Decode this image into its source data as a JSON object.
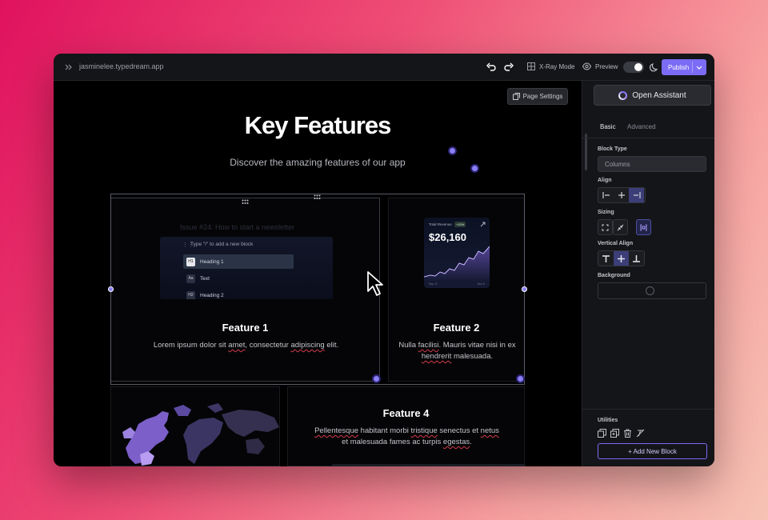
{
  "topbar": {
    "url": "jasminelee.typedream.app",
    "xray_label": "X-Ray Mode",
    "preview_label": "Preview",
    "publish_label": "Publish"
  },
  "canvas": {
    "page_settings_label": "Page Settings",
    "hero_title": "Key Features",
    "hero_subtitle": "Discover the amazing features of our app",
    "editor_preview": {
      "ghost_title": "Issue #24: How to start a newsletter",
      "hint": "Type \"/\" to add a new block",
      "items": [
        {
          "icon": "H1",
          "label": "Heading 1"
        },
        {
          "icon": "Aa",
          "label": "Text"
        },
        {
          "icon": "H2",
          "label": "Heading 2"
        }
      ]
    },
    "revenue_card": {
      "label": "Total Revenue",
      "badge": "+15%",
      "value": "$26,160",
      "x_start": "Sep 11",
      "x_end": "Nov 8"
    },
    "features": [
      {
        "title": "Feature 1",
        "desc_a": "Lorem ipsum dolor sit ",
        "desc_b": "amet",
        "desc_c": ", consectetur ",
        "desc_d": "adipiscing",
        "desc_e": " elit."
      },
      {
        "title": "Feature 2",
        "desc_a": "Nulla ",
        "desc_b": "facilisi",
        "desc_c": ". Mauris vitae nisi in ex ",
        "desc_d": "hendrerit",
        "desc_e": " malesuada."
      },
      {
        "title": "Feature 4",
        "desc_a": "Pellentesque",
        "desc_b": " habitant morbi ",
        "desc_c": "tristique",
        "desc_d": " senectus et ",
        "desc_e": "netus",
        "desc_f": " et malesuada fames ac turpis ",
        "desc_g": "egestas",
        "desc_h": "."
      }
    ]
  },
  "sidebar": {
    "open_assistant_label": "Open Assistant",
    "tabs": [
      "Basic",
      "Advanced"
    ],
    "block_type_label": "Block Type",
    "block_type_value": "Columns",
    "align_label": "Align",
    "sizing_label": "Sizing",
    "vertical_align_label": "Vertical Align",
    "background_label": "Background",
    "utilities_label": "Utilities",
    "add_block_label": "+ Add New Block"
  },
  "colors": {
    "accent": "#7b6cf6",
    "window_bg": "#000000",
    "panel_bg": "#141518"
  }
}
